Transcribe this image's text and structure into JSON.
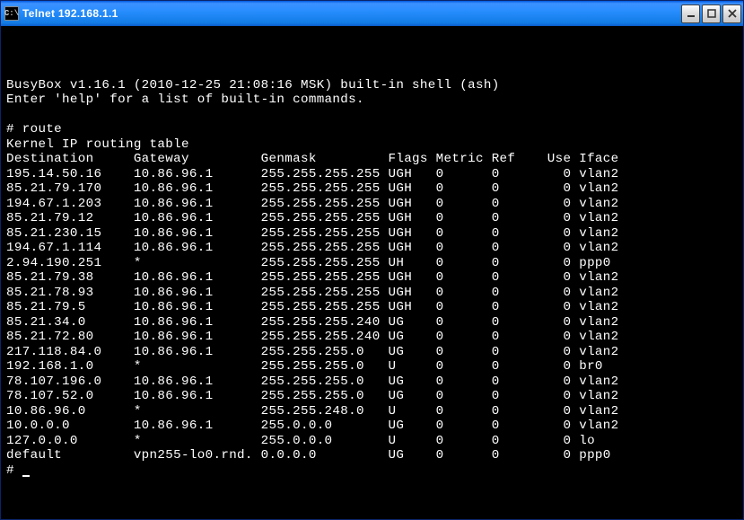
{
  "window": {
    "title": "Telnet 192.168.1.1",
    "icon_label": "C:\\"
  },
  "terminal": {
    "banner_line1": "BusyBox v1.16.1 (2010-12-25 21:08:16 MSK) built-in shell (ash)",
    "banner_line2": "Enter 'help' for a list of built-in commands.",
    "prompt": "#",
    "command": "route",
    "table_title": "Kernel IP routing table",
    "headers": {
      "destination": "Destination",
      "gateway": "Gateway",
      "genmask": "Genmask",
      "flags": "Flags",
      "metric": "Metric",
      "ref": "Ref",
      "use": "Use",
      "iface": "Iface"
    },
    "rows": [
      {
        "dest": "195.14.50.16",
        "gw": "10.86.96.1",
        "gen": "255.255.255.255",
        "flags": "UGH",
        "metric": "0",
        "ref": "0",
        "use": "0",
        "iface": "vlan2"
      },
      {
        "dest": "85.21.79.170",
        "gw": "10.86.96.1",
        "gen": "255.255.255.255",
        "flags": "UGH",
        "metric": "0",
        "ref": "0",
        "use": "0",
        "iface": "vlan2"
      },
      {
        "dest": "194.67.1.203",
        "gw": "10.86.96.1",
        "gen": "255.255.255.255",
        "flags": "UGH",
        "metric": "0",
        "ref": "0",
        "use": "0",
        "iface": "vlan2"
      },
      {
        "dest": "85.21.79.12",
        "gw": "10.86.96.1",
        "gen": "255.255.255.255",
        "flags": "UGH",
        "metric": "0",
        "ref": "0",
        "use": "0",
        "iface": "vlan2"
      },
      {
        "dest": "85.21.230.15",
        "gw": "10.86.96.1",
        "gen": "255.255.255.255",
        "flags": "UGH",
        "metric": "0",
        "ref": "0",
        "use": "0",
        "iface": "vlan2"
      },
      {
        "dest": "194.67.1.114",
        "gw": "10.86.96.1",
        "gen": "255.255.255.255",
        "flags": "UGH",
        "metric": "0",
        "ref": "0",
        "use": "0",
        "iface": "vlan2"
      },
      {
        "dest": "2.94.190.251",
        "gw": "*",
        "gen": "255.255.255.255",
        "flags": "UH",
        "metric": "0",
        "ref": "0",
        "use": "0",
        "iface": "ppp0"
      },
      {
        "dest": "85.21.79.38",
        "gw": "10.86.96.1",
        "gen": "255.255.255.255",
        "flags": "UGH",
        "metric": "0",
        "ref": "0",
        "use": "0",
        "iface": "vlan2"
      },
      {
        "dest": "85.21.78.93",
        "gw": "10.86.96.1",
        "gen": "255.255.255.255",
        "flags": "UGH",
        "metric": "0",
        "ref": "0",
        "use": "0",
        "iface": "vlan2"
      },
      {
        "dest": "85.21.79.5",
        "gw": "10.86.96.1",
        "gen": "255.255.255.255",
        "flags": "UGH",
        "metric": "0",
        "ref": "0",
        "use": "0",
        "iface": "vlan2"
      },
      {
        "dest": "85.21.34.0",
        "gw": "10.86.96.1",
        "gen": "255.255.255.240",
        "flags": "UG",
        "metric": "0",
        "ref": "0",
        "use": "0",
        "iface": "vlan2"
      },
      {
        "dest": "85.21.72.80",
        "gw": "10.86.96.1",
        "gen": "255.255.255.240",
        "flags": "UG",
        "metric": "0",
        "ref": "0",
        "use": "0",
        "iface": "vlan2"
      },
      {
        "dest": "217.118.84.0",
        "gw": "10.86.96.1",
        "gen": "255.255.255.0",
        "flags": "UG",
        "metric": "0",
        "ref": "0",
        "use": "0",
        "iface": "vlan2"
      },
      {
        "dest": "192.168.1.0",
        "gw": "*",
        "gen": "255.255.255.0",
        "flags": "U",
        "metric": "0",
        "ref": "0",
        "use": "0",
        "iface": "br0"
      },
      {
        "dest": "78.107.196.0",
        "gw": "10.86.96.1",
        "gen": "255.255.255.0",
        "flags": "UG",
        "metric": "0",
        "ref": "0",
        "use": "0",
        "iface": "vlan2"
      },
      {
        "dest": "78.107.52.0",
        "gw": "10.86.96.1",
        "gen": "255.255.255.0",
        "flags": "UG",
        "metric": "0",
        "ref": "0",
        "use": "0",
        "iface": "vlan2"
      },
      {
        "dest": "10.86.96.0",
        "gw": "*",
        "gen": "255.255.248.0",
        "flags": "U",
        "metric": "0",
        "ref": "0",
        "use": "0",
        "iface": "vlan2"
      },
      {
        "dest": "10.0.0.0",
        "gw": "10.86.96.1",
        "gen": "255.0.0.0",
        "flags": "UG",
        "metric": "0",
        "ref": "0",
        "use": "0",
        "iface": "vlan2"
      },
      {
        "dest": "127.0.0.0",
        "gw": "*",
        "gen": "255.0.0.0",
        "flags": "U",
        "metric": "0",
        "ref": "0",
        "use": "0",
        "iface": "lo"
      },
      {
        "dest": "default",
        "gw": "vpn255-lo0.rnd.",
        "gen": "0.0.0.0",
        "flags": "UG",
        "metric": "0",
        "ref": "0",
        "use": "0",
        "iface": "ppp0"
      }
    ]
  }
}
